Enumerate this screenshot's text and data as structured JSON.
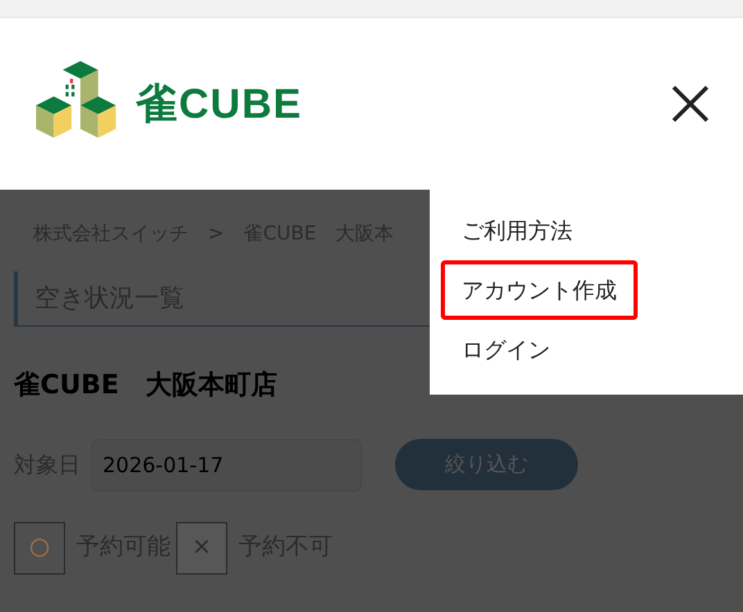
{
  "header": {
    "logo_text": "雀CUBE"
  },
  "menu": {
    "items": [
      {
        "label": "ご利用方法",
        "highlighted": false
      },
      {
        "label": "アカウント作成",
        "highlighted": true
      },
      {
        "label": "ログイン",
        "highlighted": false
      }
    ]
  },
  "breadcrumb": [
    "株式会社スイッチ",
    ">",
    "雀CUBE　大阪本"
  ],
  "section_heading": "空き状況一覧",
  "store_title": "雀CUBE　大阪本町店",
  "filter": {
    "label": "対象日",
    "date": "2026-01-17",
    "button": "絞り込む"
  },
  "legend": [
    {
      "symbol": "○",
      "label": "予約可能",
      "kind": "available"
    },
    {
      "symbol": "×",
      "label": "予約不可",
      "kind": "unavailable"
    }
  ]
}
